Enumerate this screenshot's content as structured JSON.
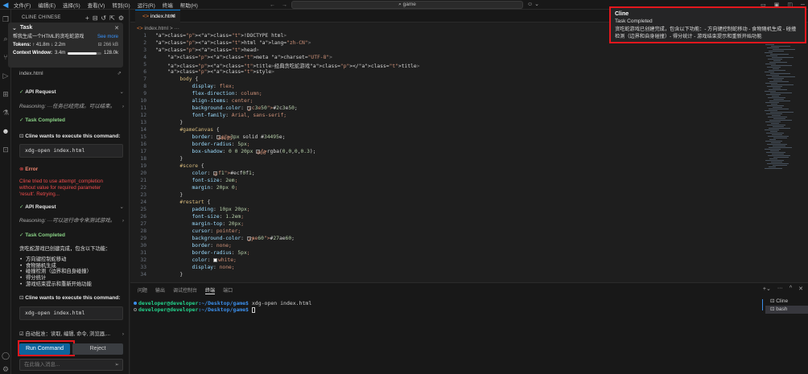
{
  "titlebar": {
    "menu": [
      "文件(F)",
      "编辑(E)",
      "选择(S)",
      "查看(V)",
      "转到(G)",
      "运行(R)",
      "终端",
      "帮助(H)"
    ],
    "search": "game"
  },
  "cline": {
    "header": "CLINE CHINESE",
    "task": {
      "label": "Task",
      "text": "帮我生成一个HTML的贪吃蛇游戏",
      "see_more": "See more",
      "tokens_label": "Tokens:",
      "tokens_up": "↑ 41.8m",
      "tokens_down": "↓ 2.2m",
      "size": "266 kB",
      "context_label": "Context Window:",
      "context_used": "3.4m",
      "context_max": "128.0k",
      "context_fraction": 0.85
    },
    "file": "index.html",
    "api_request_1": "API Request",
    "reasoning_1": "Reasoning: ···任务已经完成。可以结束。",
    "task_completed_1": "Task Completed",
    "cmd_prompt_1": "Cline wants to execute this command:",
    "cmd_1": "xdg-open index.html",
    "error_label": "Error",
    "error_text": "Cline tried to use attempt_completion without value for required parameter 'result'. Retrying...",
    "api_request_2": "API Request",
    "reasoning_2": "Reasoning: ···可以运行命令来测试游戏。",
    "task_completed_2": "Task Completed",
    "completion_intro": "贪吃蛇游戏已创建完成，包含以下功能：",
    "features": [
      "方向键控制蛇移动",
      "食物随机生成",
      "碰撞检测（边界和自身碰撞）",
      "得分统计",
      "游戏结束提示和重新开始功能"
    ],
    "cmd_prompt_2": "Cline wants to execute this command:",
    "cmd_2": "xdg-open index.html",
    "auto_approve": "自动批准：读取, 编辑, 命令, 浏览器,...",
    "run_button": "Run Command",
    "reject_button": "Reject",
    "input_placeholder": "在此输入消息..."
  },
  "editor": {
    "tab": "index.html",
    "breadcrumb": "index.html > ···",
    "lines": [
      "<!DOCTYPE html>",
      "<html lang=\"zh-CN\">",
      "<head>",
      "    <meta charset=\"UTF-8\">",
      "    <title>经典贪吃蛇游戏</title>",
      "    <style>",
      "        body {",
      "            display: flex;",
      "            flex-direction: column;",
      "            align-items: center;",
      "            background-color: #2c3e50;",
      "            font-family: Arial, sans-serif;",
      "        }",
      "        #gameCanvas {",
      "            border: 3px solid #34495e;",
      "            border-radius: 5px;",
      "            box-shadow: 0 0 20px rgba(0,0,0,0.3);",
      "        }",
      "        #score {",
      "            color: #ecf0f1;",
      "            font-size: 2em;",
      "            margin: 20px 0;",
      "        }",
      "        #restart {",
      "            padding: 10px 20px;",
      "            font-size: 1.2em;",
      "            margin-top: 20px;",
      "            cursor: pointer;",
      "            background-color: #27ae60;",
      "            border: none;",
      "            border-radius: 5px;",
      "            color: white;",
      "            display: none;",
      "        }"
    ]
  },
  "notification": {
    "title": "Cline",
    "subtitle": "Task Completed",
    "body": "贪吃蛇游戏已创建完成，包含以下功能：- 方向键控制蛇移动 - 食物随机生成 - 碰撞检测（边界和自身碰撞）- 得分统计 - 游戏结束提示和重新开始功能"
  },
  "panel": {
    "tabs": [
      "问题",
      "输出",
      "调试控制台",
      "终端",
      "端口"
    ],
    "active_tab": "终端",
    "terminal_lines": [
      {
        "prompt": "developer@developer",
        "path": ":~/Desktop/game$",
        "cmd": " xdg-open index.html"
      },
      {
        "prompt": "developer@developer",
        "path": ":~/Desktop/game$",
        "cmd": " "
      }
    ],
    "terminals": [
      "Cline",
      "bash"
    ]
  },
  "colors": {
    "accent": "#0e639c",
    "highlight": "#e3171d",
    "swatch_body": "#2c3e50",
    "swatch_border": "#34495e",
    "swatch_score": "#ecf0f1",
    "swatch_restart": "#27ae60"
  }
}
